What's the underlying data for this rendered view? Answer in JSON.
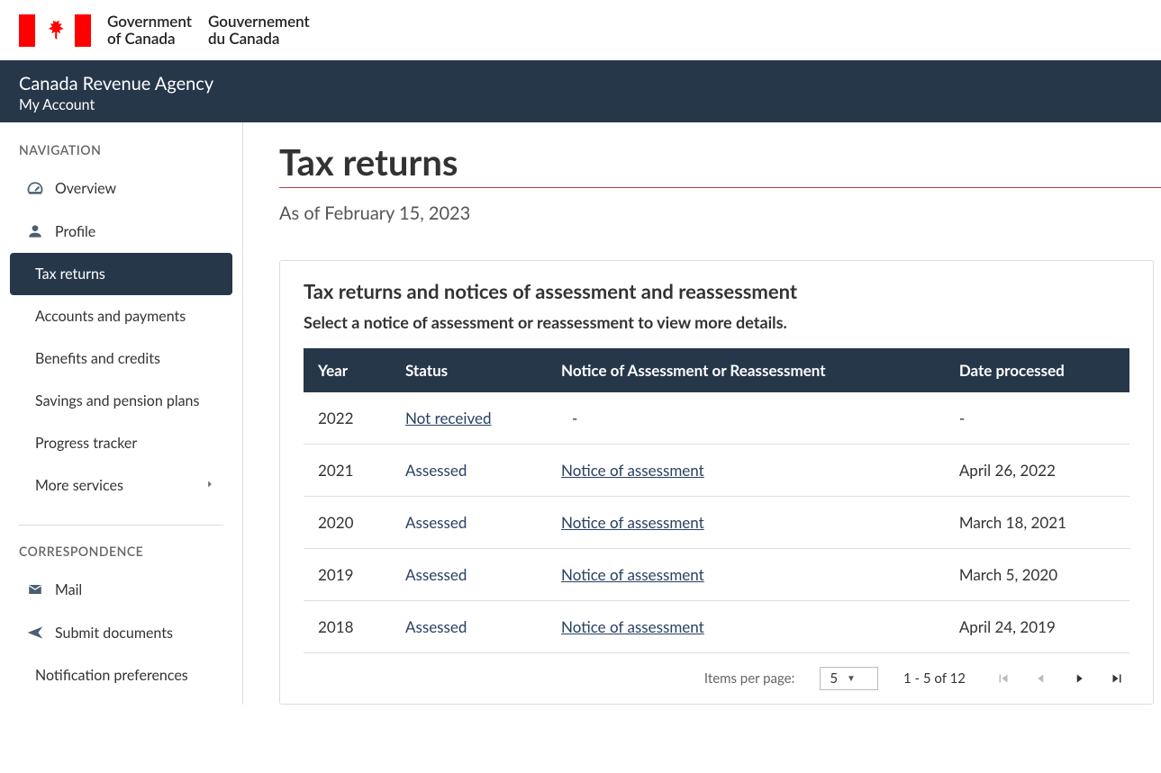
{
  "gov": {
    "en1": "Government",
    "en2": "of Canada",
    "fr1": "Gouvernement",
    "fr2": "du Canada"
  },
  "band": {
    "agency": "Canada Revenue Agency",
    "account": "My Account"
  },
  "sidebar": {
    "navHeader": "NAVIGATION",
    "items": [
      {
        "label": "Overview",
        "icon": "speed"
      },
      {
        "label": "Profile",
        "icon": "person"
      },
      {
        "label": "Tax returns",
        "active": true
      },
      {
        "label": "Accounts and payments"
      },
      {
        "label": "Benefits and credits"
      },
      {
        "label": "Savings and pension plans"
      },
      {
        "label": "Progress tracker"
      },
      {
        "label": "More services",
        "chevron": true
      }
    ],
    "corrHeader": "CORRESPONDENCE",
    "corr": [
      {
        "label": "Mail",
        "icon": "mail"
      },
      {
        "label": "Submit documents",
        "icon": "send"
      },
      {
        "label": "Notification preferences"
      }
    ]
  },
  "page": {
    "title": "Tax returns",
    "asof": "As of February 15, 2023",
    "panelTitle": "Tax returns and notices of assessment and reassessment",
    "panelSub": "Select a notice of assessment or reassessment to view more details.",
    "cols": [
      "Year",
      "Status",
      "Notice of Assessment or Reassessment",
      "Date processed"
    ],
    "rows": [
      {
        "year": "2022",
        "status": "Not received",
        "statusUnderline": true,
        "notice": "-",
        "date": "-"
      },
      {
        "year": "2021",
        "status": "Assessed",
        "notice": "Notice of assessment",
        "date": "April 26, 2022"
      },
      {
        "year": "2020",
        "status": "Assessed",
        "notice": "Notice of assessment",
        "date": "March 18, 2021"
      },
      {
        "year": "2019",
        "status": "Assessed",
        "notice": "Notice of assessment",
        "date": "March 5, 2020"
      },
      {
        "year": "2018",
        "status": "Assessed",
        "notice": "Notice of assessment",
        "date": "April 24, 2019"
      }
    ],
    "ippLabel": "Items per page:",
    "ippValue": "5",
    "range": "1 - 5 of 12"
  }
}
